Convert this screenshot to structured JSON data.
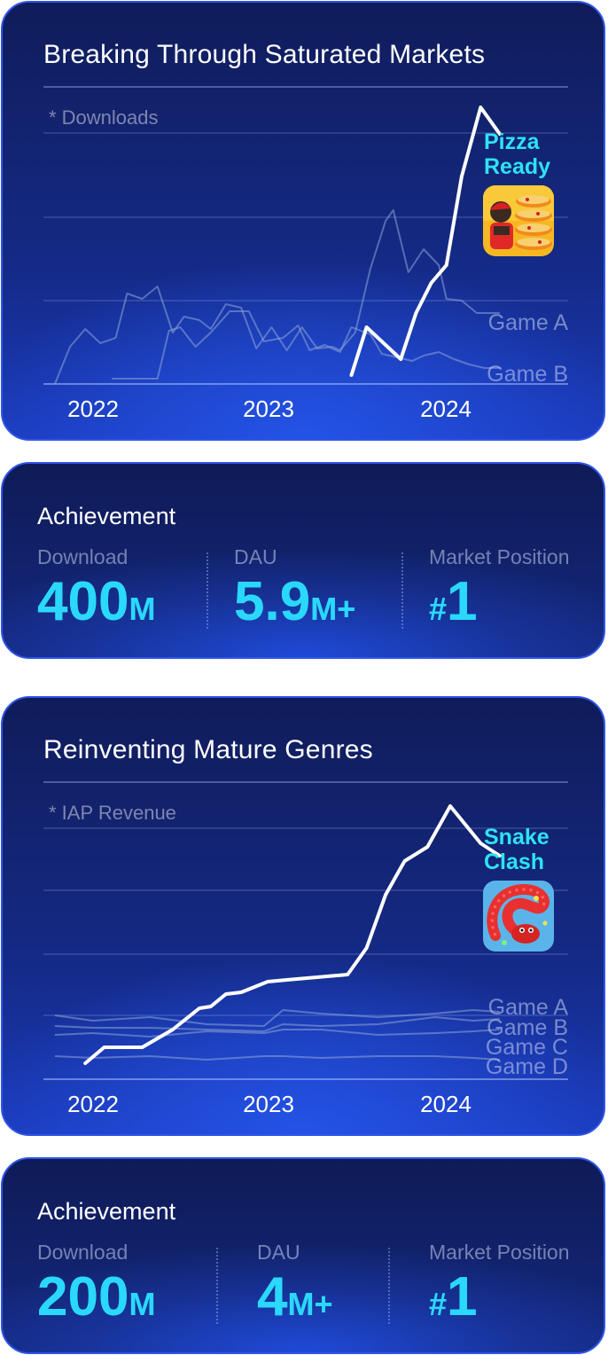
{
  "cards": [
    {
      "title": "Breaking Through Saturated Markets",
      "chart_data": {
        "type": "line",
        "annotation": "* Downloads",
        "x_ticks": [
          "2022",
          "2023",
          "2024"
        ],
        "highlight": {
          "name": "Pizza Ready",
          "name_lines": [
            "Pizza",
            "Ready"
          ],
          "icon": "pizza-stack-app-icon"
        },
        "series": [
          {
            "name": "Pizza Ready",
            "role": "highlight",
            "color": "#ffffff",
            "x": [
              2023.36,
              2023.44,
              2023.62,
              2023.7,
              2023.78,
              2023.86,
              2023.94,
              2024.04,
              2024.14
            ],
            "y": [
              10,
              64,
              28,
              80,
              114,
              134,
              234,
              312,
              282
            ]
          },
          {
            "name": "Game A",
            "role": "competitor",
            "color": "#8ea4d8",
            "x": [
              2021.8,
              2021.88,
              2021.96,
              2022.04,
              2022.12,
              2022.18,
              2022.26,
              2022.34,
              2022.42,
              2022.48,
              2022.56,
              2022.62,
              2022.7,
              2022.78,
              2022.86,
              2022.94,
              2023.02,
              2023.1,
              2023.18,
              2023.26,
              2023.3,
              2023.38,
              2023.46,
              2023.54,
              2023.58,
              2023.66,
              2023.74,
              2023.82,
              2023.86,
              2023.94,
              2024.02,
              2024.14
            ],
            "y": [
              0,
              42,
              62,
              46,
              52,
              102,
              96,
              110,
              58,
              76,
              72,
              62,
              90,
              86,
              40,
              64,
              38,
              64,
              40,
              42,
              38,
              58,
              130,
              184,
              196,
              126,
              152,
              134,
              96,
              94,
              80,
              80
            ]
          },
          {
            "name": "Game B",
            "role": "competitor",
            "color": "#8ea4d8",
            "x": [
              2022.1,
              2022.34,
              2022.4,
              2022.46,
              2022.54,
              2022.62,
              2022.72,
              2022.82,
              2022.9,
              2023.0,
              2023.08,
              2023.14,
              2023.22,
              2023.3,
              2023.36,
              2023.46,
              2023.52,
              2023.6,
              2023.68,
              2023.74,
              2023.82,
              2023.9,
              2023.98,
              2024.06,
              2024.14
            ],
            "y": [
              6,
              6,
              60,
              64,
              42,
              58,
              82,
              82,
              48,
              52,
              66,
              38,
              44,
              36,
              64,
              56,
              34,
              30,
              26,
              32,
              36,
              28,
              22,
              18,
              18
            ]
          }
        ]
      },
      "achievement": {
        "title": "Achievement",
        "stats": [
          {
            "label": "Download",
            "value": "400",
            "unit": "M",
            "prefix": ""
          },
          {
            "label": "DAU",
            "value": "5.9",
            "unit": "M+",
            "prefix": ""
          },
          {
            "label": "Market Position",
            "value": "1",
            "unit": "",
            "prefix": "#"
          }
        ]
      }
    },
    {
      "title": "Reinventing Mature Genres",
      "chart_data": {
        "type": "line",
        "annotation": "* IAP Revenue",
        "x_ticks": [
          "2022",
          "2023",
          "2024"
        ],
        "highlight": {
          "name": "Snake Clash",
          "name_lines": [
            "Snake",
            "Clash"
          ],
          "icon": "snake-app-icon"
        },
        "series": [
          {
            "name": "Snake Clash",
            "role": "highlight",
            "color": "#ffffff",
            "x": [
              2021.96,
              2022.06,
              2022.26,
              2022.42,
              2022.56,
              2022.62,
              2022.7,
              2022.78,
              2022.92,
              2023.02,
              2023.34,
              2023.44,
              2023.54,
              2023.64,
              2023.76,
              2023.88,
              2024.04,
              2024.14
            ],
            "y": [
              18,
              36,
              36,
              56,
              80,
              82,
              96,
              98,
              110,
              112,
              118,
              148,
              208,
              246,
              262,
              308,
              266,
              252
            ]
          },
          {
            "name": "Game A",
            "role": "competitor",
            "color": "#8ea4d8",
            "x": [
              2021.8,
              2022.0,
              2022.3,
              2022.6,
              2022.9,
              2023.0,
              2023.2,
              2023.5,
              2023.8,
              2024.0,
              2024.14
            ],
            "y": [
              72,
              66,
              70,
              62,
              60,
              78,
              74,
              70,
              74,
              78,
              76
            ]
          },
          {
            "name": "Game B",
            "role": "competitor",
            "color": "#8ea4d8",
            "x": [
              2021.8,
              2022.0,
              2022.3,
              2022.6,
              2022.9,
              2023.0,
              2023.2,
              2023.5,
              2023.8,
              2024.0,
              2024.14
            ],
            "y": [
              60,
              58,
              58,
              56,
              54,
              62,
              60,
              62,
              70,
              66,
              68
            ]
          },
          {
            "name": "Game C",
            "role": "competitor",
            "color": "#8ea4d8",
            "x": [
              2021.8,
              2022.0,
              2022.3,
              2022.6,
              2022.9,
              2023.0,
              2023.2,
              2023.5,
              2023.8,
              2024.0,
              2024.14
            ],
            "y": [
              50,
              52,
              48,
              54,
              52,
              56,
              56,
              50,
              52,
              54,
              56
            ]
          },
          {
            "name": "Game D",
            "role": "competitor",
            "color": "#8ea4d8",
            "x": [
              2021.8,
              2022.0,
              2022.3,
              2022.6,
              2022.9,
              2023.0,
              2023.2,
              2023.5,
              2023.8,
              2024.0,
              2024.14
            ],
            "y": [
              26,
              24,
              26,
              22,
              26,
              26,
              24,
              26,
              26,
              24,
              22
            ]
          }
        ]
      },
      "achievement": {
        "title": "Achievement",
        "stats": [
          {
            "label": "Download",
            "value": "200",
            "unit": "M",
            "prefix": ""
          },
          {
            "label": "DAU",
            "value": "4",
            "unit": "M+",
            "prefix": ""
          },
          {
            "label": "Market Position",
            "value": "1",
            "unit": "",
            "prefix": "#"
          }
        ]
      }
    }
  ]
}
